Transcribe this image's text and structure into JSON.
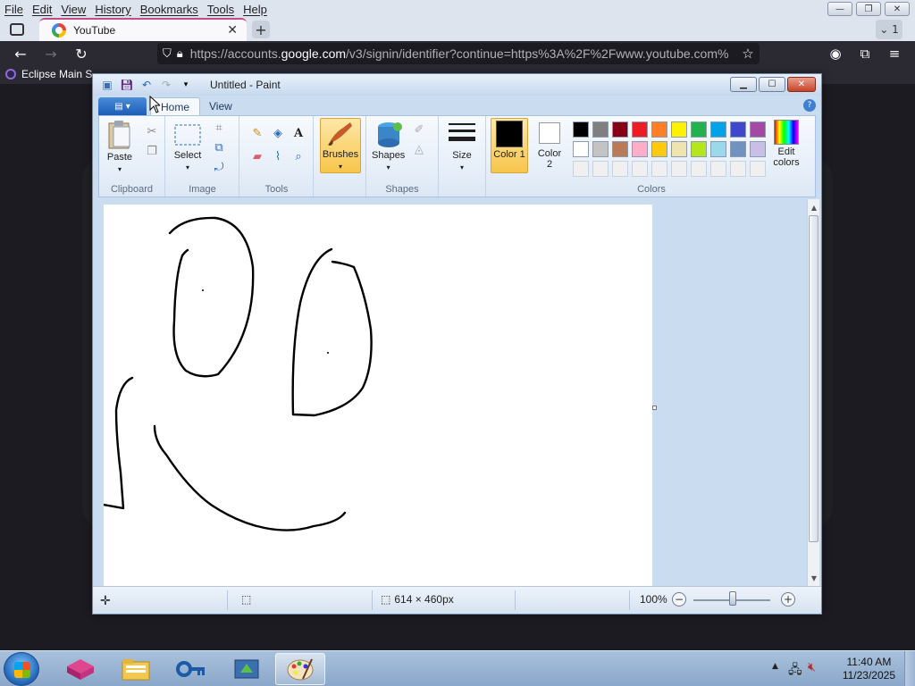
{
  "browser": {
    "menu": [
      "File",
      "Edit",
      "View",
      "History",
      "Bookmarks",
      "Tools",
      "Help"
    ],
    "window_controls": {
      "minimize": "—",
      "restore": "❐",
      "close": "✕"
    },
    "tab": {
      "title": "YouTube",
      "close": "✕"
    },
    "new_tab": "+",
    "tab_count": "⌄ 1",
    "url": {
      "prefix": "https://accounts.",
      "host": "google.com",
      "path": "/v3/signin/identifier?continue=https%3A%2F%2Fwww.youtube.com%"
    },
    "bookmarks": [
      {
        "label": "Eclipse Main S"
      }
    ]
  },
  "paint": {
    "title": "Untitled - Paint",
    "tabs": {
      "home": "Home",
      "view": "View"
    },
    "groups": {
      "clipboard": "Clipboard",
      "image": "Image",
      "tools": "Tools",
      "shapes": "Shapes",
      "colors": "Colors"
    },
    "buttons": {
      "paste": "Paste",
      "select": "Select",
      "brushes": "Brushes",
      "shapes": "Shapes",
      "size": "Size",
      "color1": "Color 1",
      "color2": "Color 2",
      "edit_colors": "Edit colors"
    },
    "palette_row1": [
      "#000000",
      "#7f7f7f",
      "#880015",
      "#ed1c24",
      "#ff7f27",
      "#fff200",
      "#22b14c",
      "#00a2e8",
      "#3f48cc",
      "#a349a4"
    ],
    "palette_row2": [
      "#ffffff",
      "#c3c3c3",
      "#b97a57",
      "#ffaec9",
      "#ffc90e",
      "#efe4b0",
      "#b5e61d",
      "#99d9ea",
      "#7092be",
      "#c8bfe7"
    ],
    "palette_row3": [
      "#f0f0f0",
      "#f0f0f0",
      "#f0f0f0",
      "#f0f0f0",
      "#f0f0f0",
      "#f0f0f0",
      "#f0f0f0",
      "#f0f0f0",
      "#f0f0f0",
      "#f0f0f0"
    ],
    "status": {
      "size": "614 × 460px",
      "zoom": "100%"
    },
    "colors": {
      "color1": "#000000",
      "color2": "#ffffff",
      "accent": "#f7c54a"
    }
  },
  "taskbar": {
    "time": "11:40 AM",
    "date": "11/23/2025"
  }
}
